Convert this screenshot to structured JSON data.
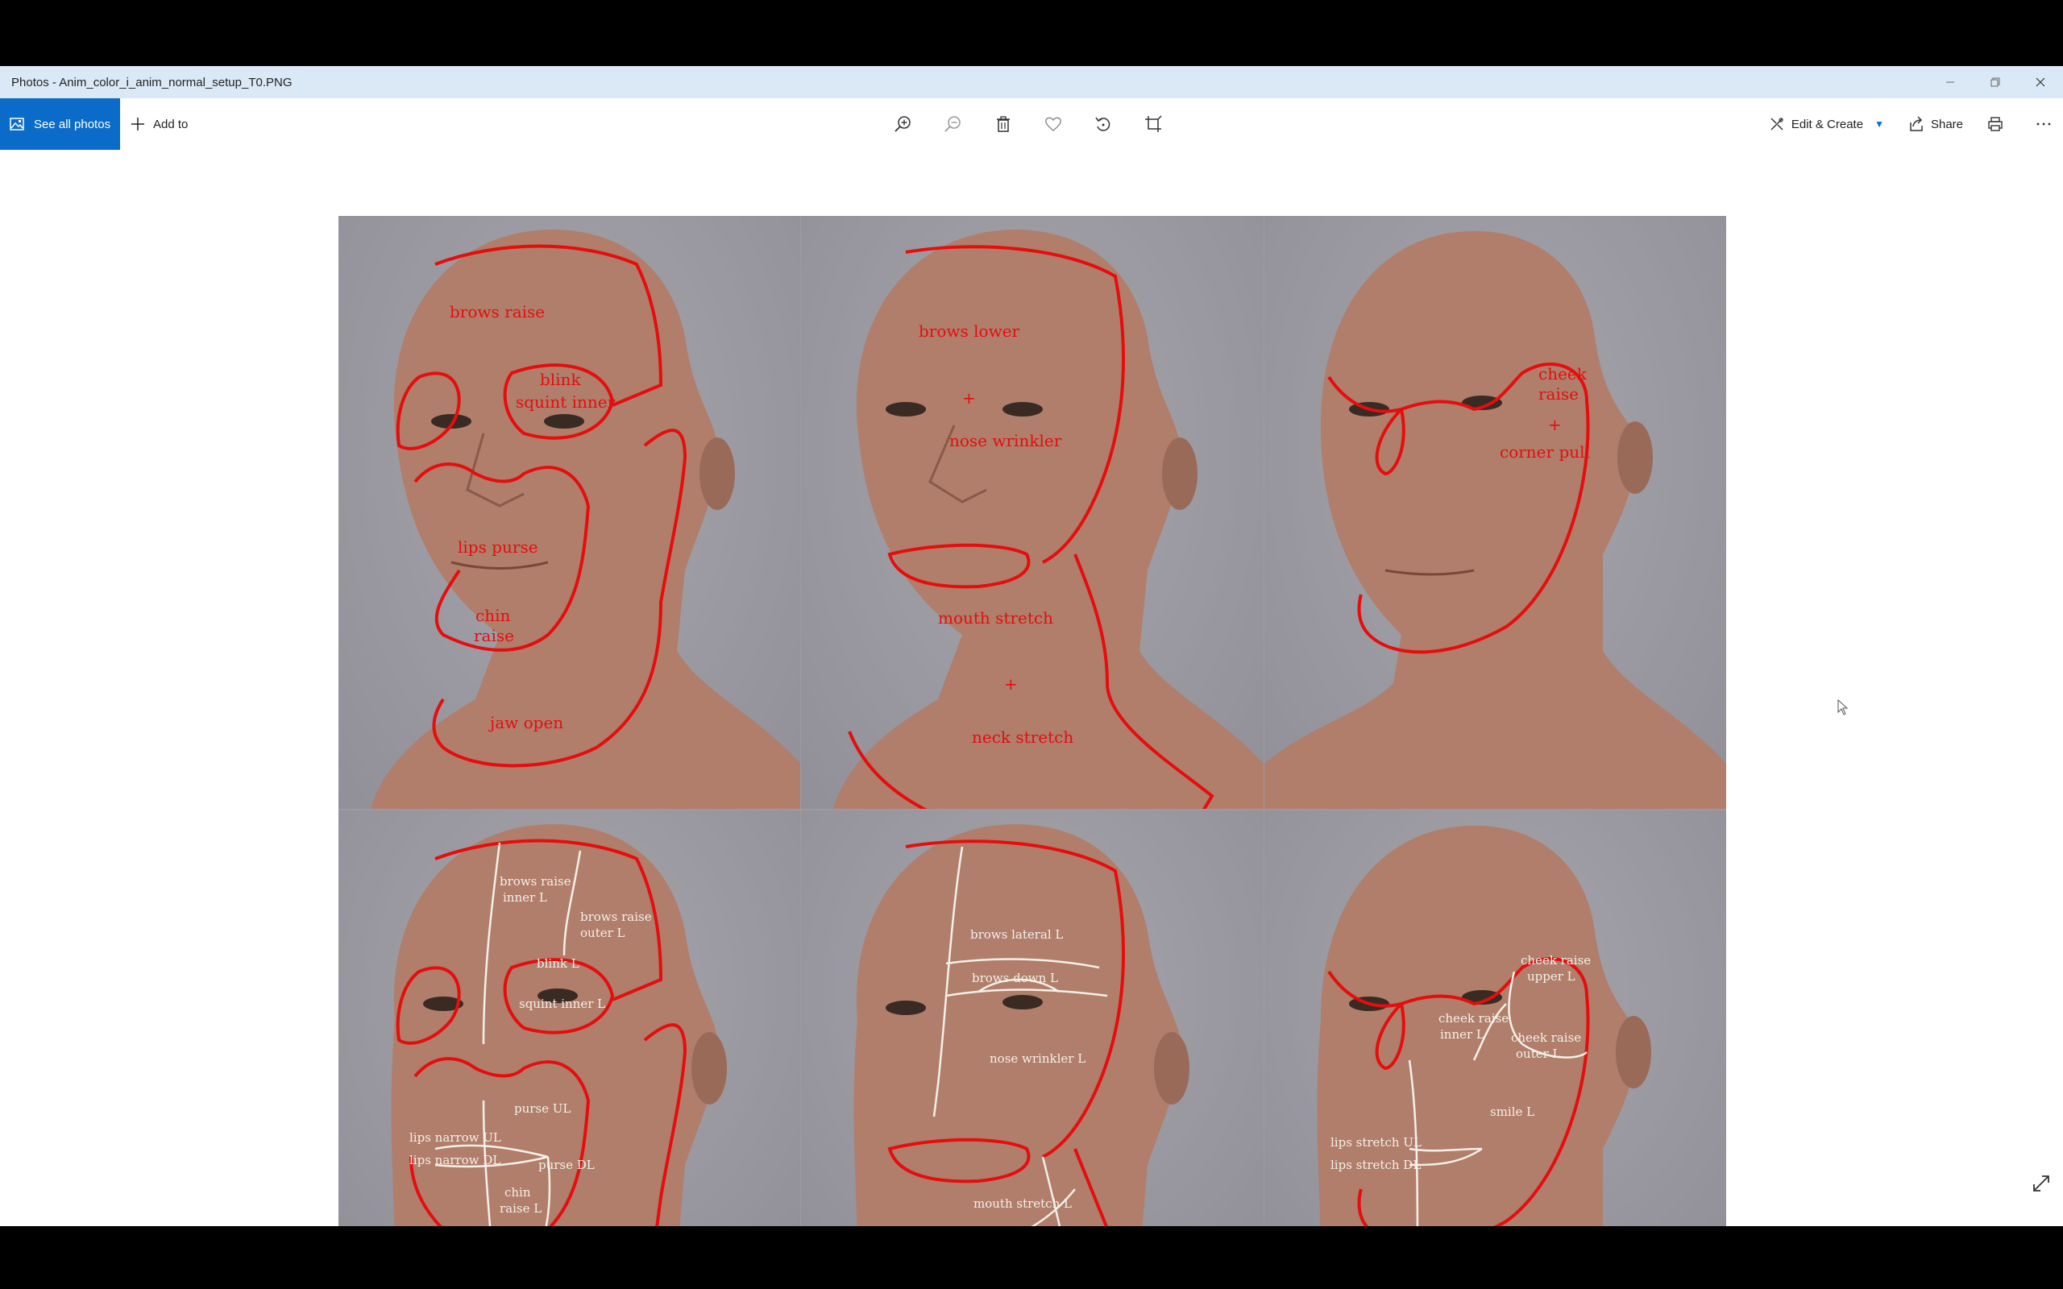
{
  "window": {
    "title": "Photos - Anim_color_i_anim_normal_setup_T0.PNG"
  },
  "toolbar": {
    "see_all_photos": "See all photos",
    "add_to": "Add to",
    "edit_create": "Edit & Create",
    "share": "Share",
    "icons": [
      "zoom-in-icon",
      "zoom-out-icon",
      "delete-icon",
      "favorite-icon",
      "rotate-icon",
      "crop-icon",
      "print-icon",
      "more-icon"
    ]
  },
  "colors": {
    "accent": "#0a6cc8",
    "titlebar": "#dbe9f6",
    "red_outline": "#e60d0d",
    "white_outline": "#f4f0ea",
    "background_gray": "#9c9ba3",
    "skin": "#b07e6a"
  },
  "image": {
    "top_row": {
      "left": [
        "brows raise",
        "blink",
        "squint inner",
        "lips purse",
        "chin",
        "raise",
        "jaw open"
      ],
      "center": [
        "brows lower",
        "+",
        "nose wrinkler",
        "mouth stretch",
        "+",
        "neck stretch"
      ],
      "right": [
        "cheek",
        "raise",
        "+",
        "corner pull"
      ]
    },
    "bottom_row": {
      "left": [
        "brows raise",
        "inner L",
        "brows raise",
        "outer L",
        "blink L",
        "squint inner L",
        "purse UL",
        "lips narrow UL",
        "lips narrow DL",
        "purse DL",
        "chin",
        "raise L"
      ],
      "center": [
        "brows lateral L",
        "brows down L",
        "nose wrinkler L",
        "mouth stretch L"
      ],
      "right": [
        "cheek raise",
        "upper L",
        "cheek raise",
        "inner L",
        "cheek raise",
        "outer L",
        "smile L",
        "lips stretch UL",
        "lips stretch DL"
      ]
    }
  }
}
